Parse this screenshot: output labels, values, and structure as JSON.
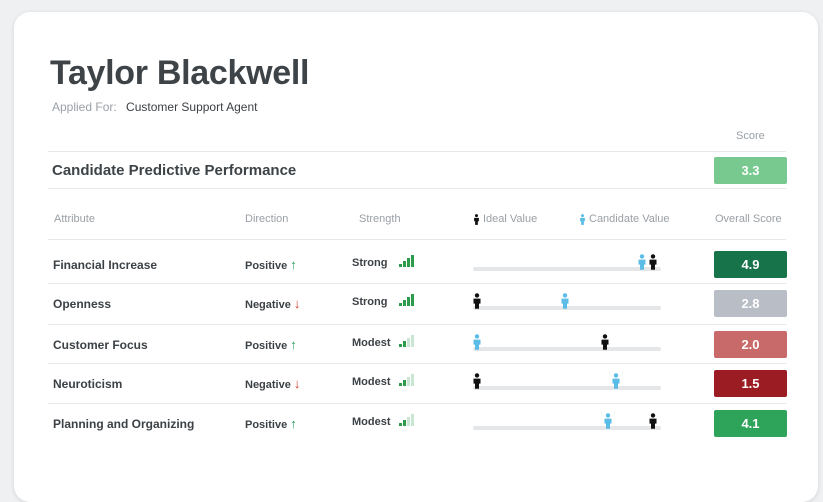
{
  "candidate": {
    "name": "Taylor Blackwell",
    "applied_label": "Applied For:",
    "applied_value": "Customer Support Agent"
  },
  "summary": {
    "score_header": "Score",
    "title": "Candidate Predictive Performance",
    "score": "3.3",
    "score_color": "#78c98f"
  },
  "columns": {
    "attribute": "Attribute",
    "direction": "Direction",
    "strength": "Strength",
    "ideal_value": "Ideal Value",
    "candidate_value": "Candidate Value",
    "overall_score": "Overall Score"
  },
  "colors": {
    "ideal_icon": "#111111",
    "candidate_icon": "#5bbde6",
    "positive_arrow": "#23a05a",
    "negative_arrow": "#d2392b",
    "strength_on": "#2e9a4b",
    "strength_off": "#c9e6d2"
  },
  "rows": [
    {
      "attribute": "Financial Increase",
      "direction": "Positive",
      "direction_arrow": "↑",
      "direction_dir": "up",
      "strength": "Strength_Strong",
      "strength_text": "Strong",
      "strength_level": 4,
      "ideal": 0.96,
      "candidate": 0.9,
      "score": "4.9",
      "score_color": "#17744a"
    },
    {
      "attribute": "Openness",
      "direction": "Negative",
      "direction_arrow": "↓",
      "direction_dir": "down",
      "strength_text": "Strong",
      "strength_level": 4,
      "ideal": 0.02,
      "candidate": 0.49,
      "score": "2.8",
      "score_color": "#b9bec6"
    },
    {
      "attribute": "Customer Focus",
      "direction": "Positive",
      "direction_arrow": "↑",
      "direction_dir": "up",
      "strength_text": "Modest",
      "strength_level": 2,
      "ideal": 0.7,
      "candidate": 0.02,
      "score": "2.0",
      "score_color": "#c96a6a"
    },
    {
      "attribute": "Neuroticism",
      "direction": "Negative",
      "direction_arrow": "↓",
      "direction_dir": "down",
      "strength_text": "Modest",
      "strength_level": 2,
      "ideal": 0.02,
      "candidate": 0.76,
      "score": "1.5",
      "score_color": "#9b1c22"
    },
    {
      "attribute": "Planning and Organizing",
      "direction": "Positive",
      "direction_arrow": "↑",
      "direction_dir": "up",
      "strength_text": "Modest",
      "strength_level": 2,
      "ideal": 0.96,
      "candidate": 0.72,
      "score": "4.1",
      "score_color": "#2ea35a"
    }
  ]
}
